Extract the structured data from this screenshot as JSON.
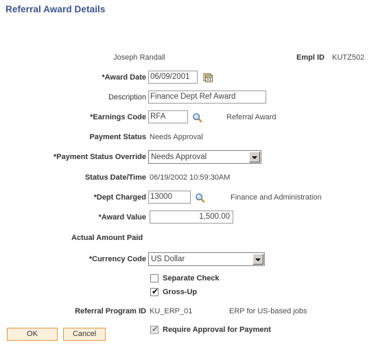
{
  "page": {
    "title": "Referral Award Details"
  },
  "header": {
    "employee_name": "Joseph Randall",
    "empl_id_label": "Empl ID",
    "empl_id_value": "KUTZ502"
  },
  "fields": {
    "award_date": {
      "label": "*Award Date",
      "value": "06/09/2001",
      "icon": "calendar-icon"
    },
    "description": {
      "label": "Description",
      "value": "Finance Dept Ref Award"
    },
    "earnings_code": {
      "label": "*Earnings Code",
      "value": "RFA",
      "icon": "lookup-magnifier-icon",
      "description": "Referral Award"
    },
    "payment_status": {
      "label": "Payment Status",
      "value": "Needs Approval"
    },
    "payment_status_override": {
      "label": "*Payment Status Override",
      "value": "Needs Approval",
      "options": [
        "Needs Approval"
      ]
    },
    "status_date_time": {
      "label": "Status Date/Time",
      "value": "06/19/2002 10:59:30AM"
    },
    "dept_charged": {
      "label": "*Dept Charged",
      "value": "13000",
      "icon": "lookup-magnifier-icon",
      "description": "Finance and Administration"
    },
    "award_value": {
      "label": "*Award Value",
      "value": "1,500.00"
    },
    "actual_amount_paid": {
      "label": "Actual Amount Paid"
    },
    "currency_code": {
      "label": "*Currency Code",
      "value": "US Dollar",
      "options": [
        "US Dollar"
      ]
    },
    "separate_check": {
      "label": "Separate Check",
      "checked": false
    },
    "gross_up": {
      "label": "Gross-Up",
      "checked": true
    },
    "referral_program_id": {
      "label": "Referral Program ID",
      "value": "KU_ERP_01",
      "description": "ERP for US-based jobs"
    },
    "require_approval": {
      "label": "Require Approval for Payment",
      "checked": true,
      "disabled": true
    }
  },
  "buttons": {
    "ok": "OK",
    "cancel": "Cancel"
  },
  "colors": {
    "title": "#39538e",
    "button_bg": "#fcefdc",
    "button_border": "#e2973c",
    "label_text": "#333333",
    "value_text": "#4a4a4a"
  }
}
